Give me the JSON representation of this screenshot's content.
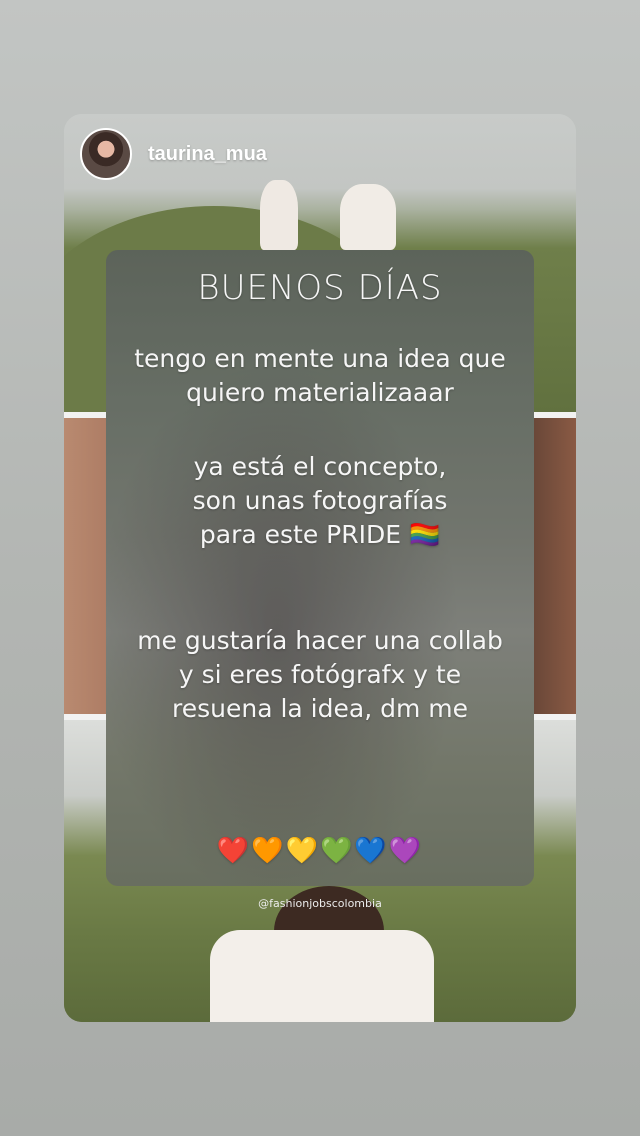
{
  "story": {
    "username": "taurina_mua",
    "credit": "@fashionjobscolombia"
  },
  "post": {
    "greeting": "BUENOS DÍAS",
    "paragraphs": [
      "tengo en mente una idea que quiero materializaaar",
      "ya está el concepto, son unas fotografías para este PRIDE 🏳️‍🌈",
      "me gustaría hacer una collab y si eres fotógrafx y te resuena la idea, dm me"
    ],
    "hearts": "❤️🧡💛💚💙💜"
  }
}
